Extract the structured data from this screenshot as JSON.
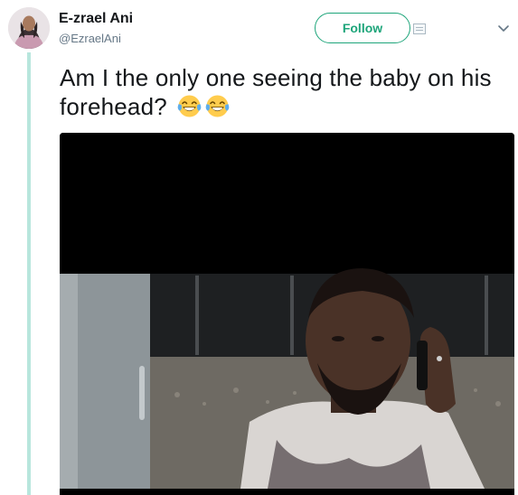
{
  "tweet": {
    "author": {
      "display_name": "E-zrael Ani",
      "handle": "@EzraelAni",
      "avatar_icon": "profile-photo"
    },
    "follow_label": "Follow",
    "text": "Am I the only one seeing the baby on his forehead?",
    "emojis": [
      "face-with-tears-of-joy",
      "face-with-tears-of-joy"
    ],
    "media_description_icon": "video-still-man-on-phone"
  },
  "colors": {
    "accent": "#1da57a",
    "thread_line": "#b8e6dd",
    "text_primary": "#14171a",
    "text_secondary": "#657786"
  }
}
